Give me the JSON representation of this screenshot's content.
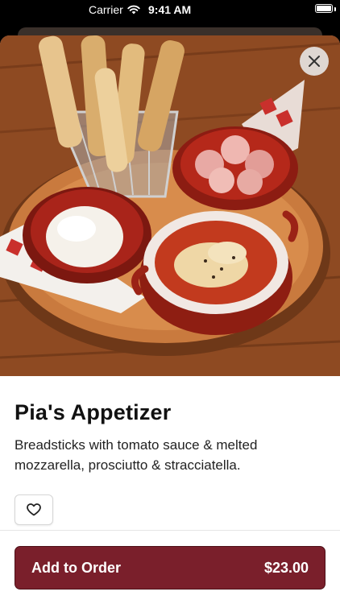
{
  "status_bar": {
    "carrier": "Carrier",
    "time": "9:41 AM",
    "wifi_icon": "wifi-icon",
    "battery_icon": "battery-icon"
  },
  "item": {
    "title": "Pia's Appetizer",
    "description": "Breadsticks with tomato sauce & melted mozzarella, prosciutto & stracciatella.",
    "image_subject": "food-photo",
    "close_icon": "close-icon",
    "favorite_icon": "heart-icon"
  },
  "order_button": {
    "label": "Add to Order",
    "price": "$23.00"
  },
  "colors": {
    "accent": "#7a1f2b",
    "accent_border": "#4d0f17"
  }
}
